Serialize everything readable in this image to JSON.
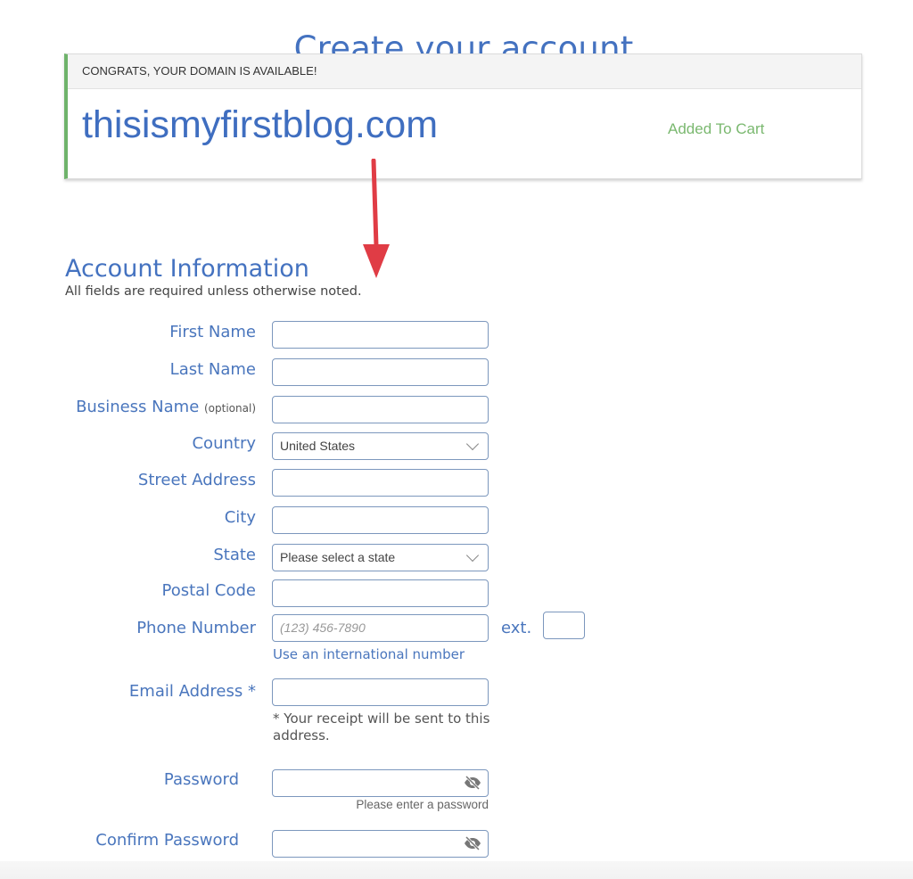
{
  "page": {
    "title": "Create your account"
  },
  "domain_card": {
    "header": "CONGRATS, YOUR DOMAIN IS AVAILABLE!",
    "domain": "thisismyfirstblog.com",
    "status": "Added To Cart",
    "colors": {
      "accent_bar": "#6fb36b",
      "domain_text": "#3f6ec0",
      "status_text": "#7ab86f"
    }
  },
  "annotation": {
    "arrow_color": "#e03c45"
  },
  "account": {
    "title": "Account Information",
    "note": "All fields are required unless otherwise noted.",
    "fields": {
      "first_name": {
        "label": "First Name",
        "value": ""
      },
      "last_name": {
        "label": "Last Name",
        "value": ""
      },
      "business_name": {
        "label": "Business Name",
        "suffix": "(optional)",
        "value": ""
      },
      "country": {
        "label": "Country",
        "selected": "United States"
      },
      "street_address": {
        "label": "Street Address",
        "value": ""
      },
      "city": {
        "label": "City",
        "value": ""
      },
      "state": {
        "label": "State",
        "selected": "Please select a state"
      },
      "postal_code": {
        "label": "Postal Code",
        "value": ""
      },
      "phone": {
        "label": "Phone Number",
        "placeholder": "(123) 456-7890",
        "ext_label": "ext.",
        "intl_link": "Use an international number"
      },
      "email": {
        "label": "Email Address *",
        "value": "",
        "help": "* Your receipt will be sent to this address."
      },
      "password": {
        "label": "Password",
        "value": "",
        "help": "Please enter a password",
        "icon": "eye-slash-icon"
      },
      "confirm_password": {
        "label": "Confirm Password",
        "value": "",
        "icon": "eye-slash-icon"
      }
    }
  }
}
